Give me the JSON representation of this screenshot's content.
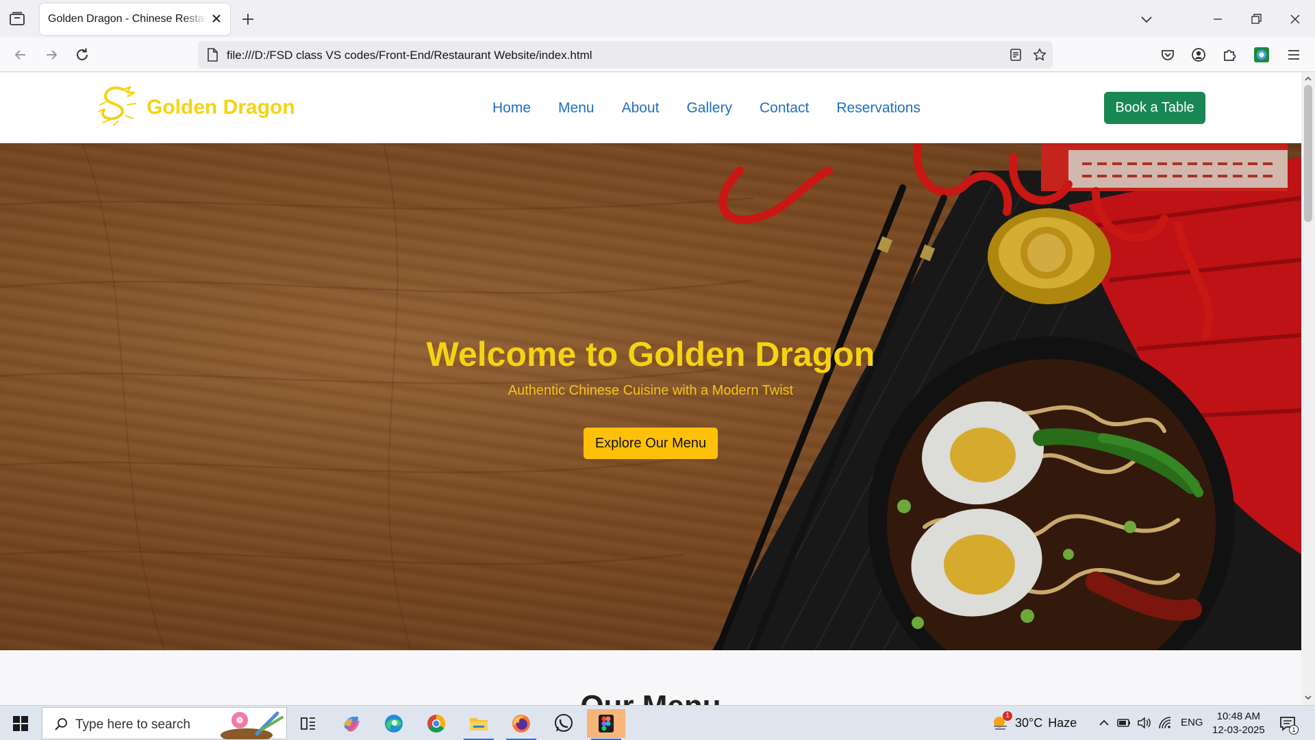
{
  "browser": {
    "tab_title": "Golden Dragon - Chinese Restaurant",
    "url": "file:///D:/FSD class VS codes/Front-End/Restaurant Website/index.html"
  },
  "site": {
    "logo_text": "Golden Dragon",
    "nav": [
      "Home",
      "Menu",
      "About",
      "Gallery",
      "Contact",
      "Reservations"
    ],
    "cta_label": "Book a Table",
    "hero": {
      "title": "Welcome to Golden Dragon",
      "subtitle": "Authentic Chinese Cuisine with a Modern Twist",
      "button": "Explore Our Menu"
    },
    "section_heading": "Our Menu"
  },
  "taskbar": {
    "search_placeholder": "Type here to search",
    "weather_temp": "30°C",
    "weather_desc": "Haze",
    "weather_badge": "1",
    "language": "ENG",
    "time": "10:48 AM",
    "date": "12-03-2025",
    "notification_count": "1"
  },
  "colors": {
    "brand_gold": "#f5d312",
    "nav_link": "#1f6fbf",
    "cta_green": "#198754",
    "hero_button": "#ffc107"
  }
}
